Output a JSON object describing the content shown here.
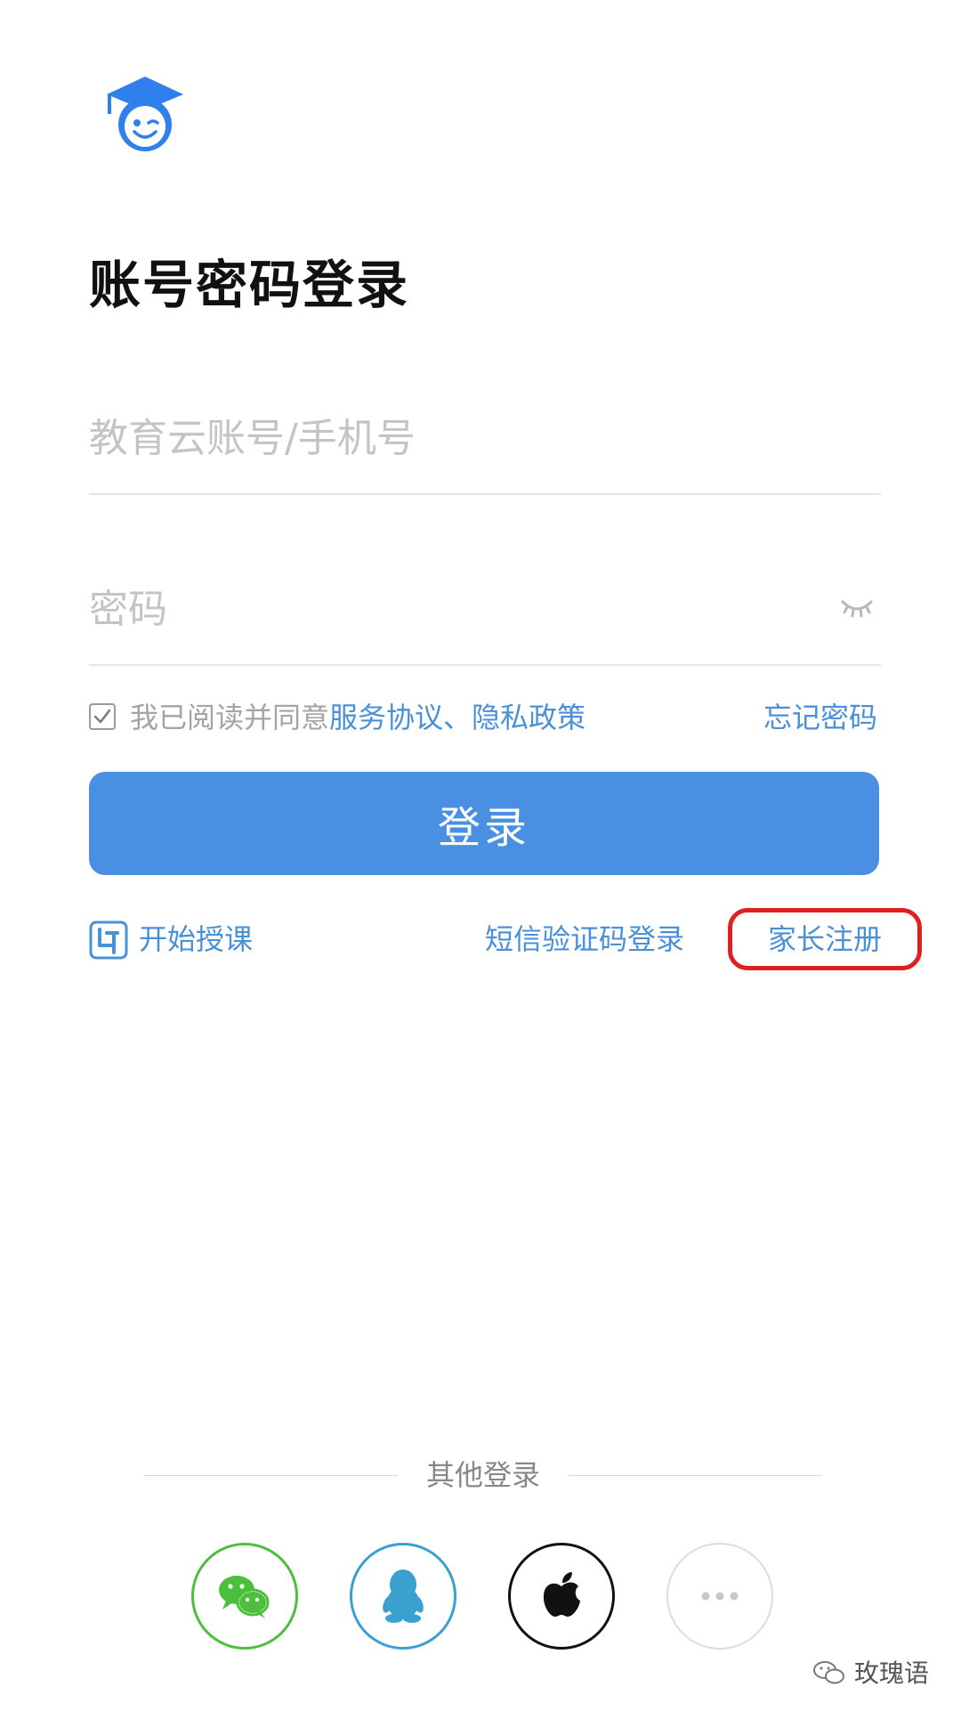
{
  "app": {
    "logo_icon": "graduation-cap-face-icon"
  },
  "page": {
    "title": "账号密码登录"
  },
  "form": {
    "account_placeholder": "教育云账号/手机号",
    "account_value": "",
    "password_placeholder": "密码",
    "password_value": "",
    "password_toggle_icon": "eye-closed-icon",
    "agreement": {
      "checked": true,
      "prefix": "我已阅读并同意",
      "service_link": "服务协议",
      "separator": "、",
      "privacy_link": "隐私政策"
    },
    "forgot_password": "忘记密码",
    "login_button": "登录"
  },
  "links": {
    "start_teaching": "开始授课",
    "start_teaching_icon": "teaching-app-icon",
    "sms_login": "短信验证码登录",
    "parent_register": "家长注册",
    "parent_register_highlight_color": "#e02020"
  },
  "other_login": {
    "label": "其他登录",
    "providers": [
      {
        "name": "wechat",
        "icon": "wechat-icon",
        "color": "#4cbf3c"
      },
      {
        "name": "qq",
        "icon": "qq-icon",
        "color": "#3aa0d0"
      },
      {
        "name": "apple",
        "icon": "apple-icon",
        "color": "#111111"
      },
      {
        "name": "more",
        "icon": "more-dots-icon",
        "color": "#cccccc"
      }
    ]
  },
  "watermark": {
    "text": "玫瑰语",
    "icon": "wechat-outline-icon"
  },
  "colors": {
    "primary": "#4a90e2",
    "link": "#4a90d9",
    "placeholder": "#c4c4c4"
  }
}
